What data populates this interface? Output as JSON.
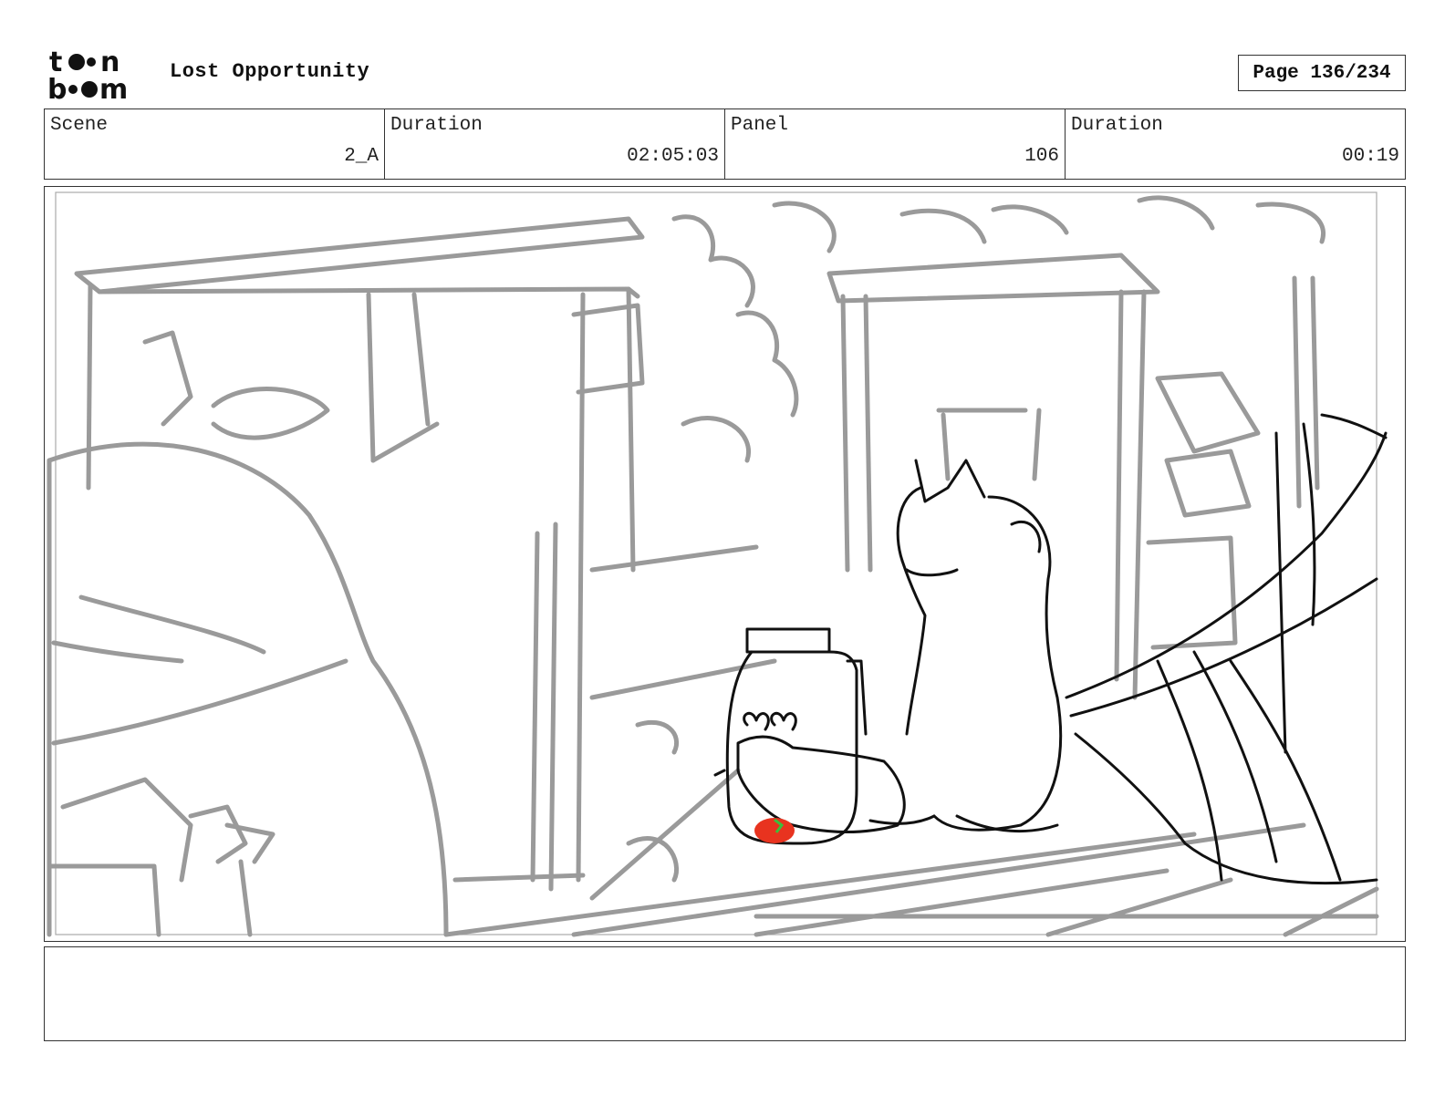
{
  "header": {
    "logo_text": "toon boom",
    "project_title": "Lost Opportunity",
    "page_indicator": "Page 136/234"
  },
  "info": {
    "scene_label": "Scene",
    "scene_value": "2_A",
    "scene_duration_label": "Duration",
    "scene_duration_value": "02:05:03",
    "panel_label": "Panel",
    "panel_value": "106",
    "panel_duration_label": "Duration",
    "panel_duration_value": "00:19"
  },
  "panel": {
    "image_icon": "storyboard-sketch",
    "colors": {
      "sketch_gray": "#9a9a9a",
      "ink": "#111111",
      "accent_red": "#e8331f",
      "accent_green": "#3cbf3c"
    }
  },
  "notes": {
    "text": ""
  }
}
